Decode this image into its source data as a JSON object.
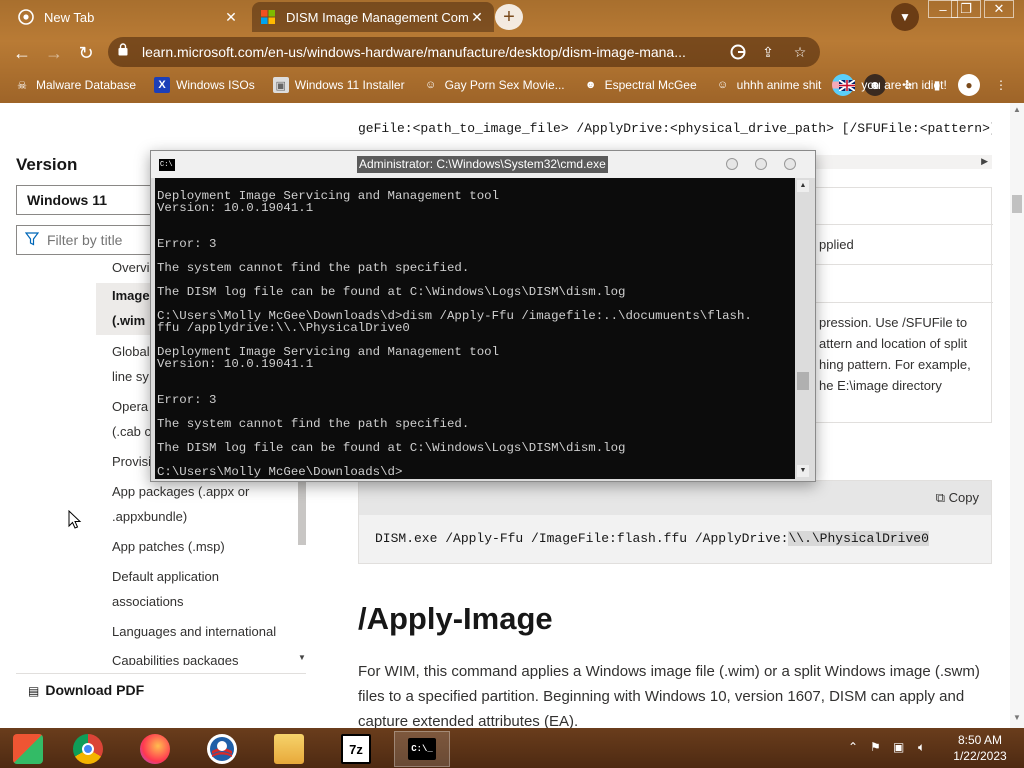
{
  "browser": {
    "tabs": [
      {
        "title": "New Tab",
        "close": "✕"
      },
      {
        "title": "DISM Image Management Comm",
        "close": "✕"
      }
    ],
    "new_tab": "+",
    "window_controls": {
      "min": "–",
      "max": "❐",
      "close": "✕"
    },
    "url": "learn.microsoft.com/en-us/windows-hardware/manufacture/desktop/dism-image-mana...",
    "bookmarks": [
      {
        "label": "Malware Database",
        "icon": "skull-icon"
      },
      {
        "label": "Windows ISOs",
        "icon": "x-logo-icon"
      },
      {
        "label": "Windows 11 Installer",
        "icon": "image-icon"
      },
      {
        "label": "Gay Porn Sex Movie...",
        "icon": "bookmark-face-icon"
      },
      {
        "label": "Espectral McGee",
        "icon": "bookmark-ghost-icon"
      },
      {
        "label": "uhhh anime shit",
        "icon": "bookmark-anime-icon"
      },
      {
        "label": "you are an idiot!",
        "icon": "uk-flag-icon"
      }
    ]
  },
  "sidebar": {
    "version_label": "Version",
    "version_value": "Windows 11",
    "filter_placeholder": "Filter by title",
    "toc": [
      {
        "label": "Overvi"
      },
      {
        "label": "Image"
      },
      {
        "label": "(.wim"
      },
      {
        "label": "Global"
      },
      {
        "label": "line sy"
      },
      {
        "label": "Opera"
      },
      {
        "label": "(.cab c"
      },
      {
        "label": "Provisi"
      },
      {
        "label": "App packages (.appx or"
      },
      {
        "label": ".appxbundle)"
      },
      {
        "label": "App patches (.msp)"
      },
      {
        "label": "Default application"
      },
      {
        "label": "associations"
      },
      {
        "label": "Languages and international"
      },
      {
        "label": "Capabilities packages"
      }
    ],
    "download_pdf": "Download PDF"
  },
  "content": {
    "syntax": "geFile:<path_to_image_file> /ApplyDrive:<physical_drive_path> [/SFUFile:<pattern>]",
    "table_fragments": [
      "pplied",
      "pression. Use /SFUFile to",
      "attern and location of split",
      "hing pattern. For example,",
      "he E:\\image directory"
    ],
    "copy_label": "Copy",
    "code_prefix": "DISM.exe /Apply-Ffu /ImageFile:flash.ffu /ApplyDrive:",
    "code_highlight": "\\\\.\\PhysicalDrive0",
    "heading": "/Apply-Image",
    "paragraph": "For WIM, this command applies a Windows image file (.wim) or a split Windows image (.swm) files to a specified partition. Beginning with Windows 10, version 1607, DISM can apply and capture extended attributes (EA)."
  },
  "cmd": {
    "title": "Administrator: C:\\Windows\\System32\\cmd.exe",
    "lines": [
      "Deployment Image Servicing and Management tool",
      "Version: 10.0.19041.1",
      "",
      "",
      "Error: 3",
      "",
      "The system cannot find the path specified.",
      "",
      "The DISM log file can be found at C:\\Windows\\Logs\\DISM\\dism.log",
      "",
      "C:\\Users\\Molly McGee\\Downloads\\d>dism /Apply-Ffu /imagefile:..\\documuents\\flash.",
      "ffu /applydrive:\\\\.\\PhysicalDrive0",
      "",
      "Deployment Image Servicing and Management tool",
      "Version: 10.0.19041.1",
      "",
      "",
      "Error: 3",
      "",
      "The system cannot find the path specified.",
      "",
      "The DISM log file can be found at C:\\Windows\\Logs\\DISM\\dism.log",
      "",
      "C:\\Users\\Molly McGee\\Downloads\\d>"
    ]
  },
  "taskbar": {
    "apps": [
      {
        "name": "start-icon",
        "label": ""
      },
      {
        "name": "chrome-icon",
        "label": ""
      },
      {
        "name": "firefox-icon",
        "label": ""
      },
      {
        "name": "obama-logo-icon",
        "label": ""
      },
      {
        "name": "file-explorer-icon",
        "label": ""
      },
      {
        "name": "7zip-icon",
        "label": "7z"
      },
      {
        "name": "cmd-icon",
        "label": "C:\\_"
      }
    ],
    "time": "8:50 AM",
    "date": "1/22/2023"
  },
  "colors": {
    "chrome_theme": "#a86f2e",
    "taskbar": "#5a3218",
    "console_bg": "#0c0c0c",
    "console_text": "#cfcfcf",
    "ms_link": "#0067b8"
  }
}
